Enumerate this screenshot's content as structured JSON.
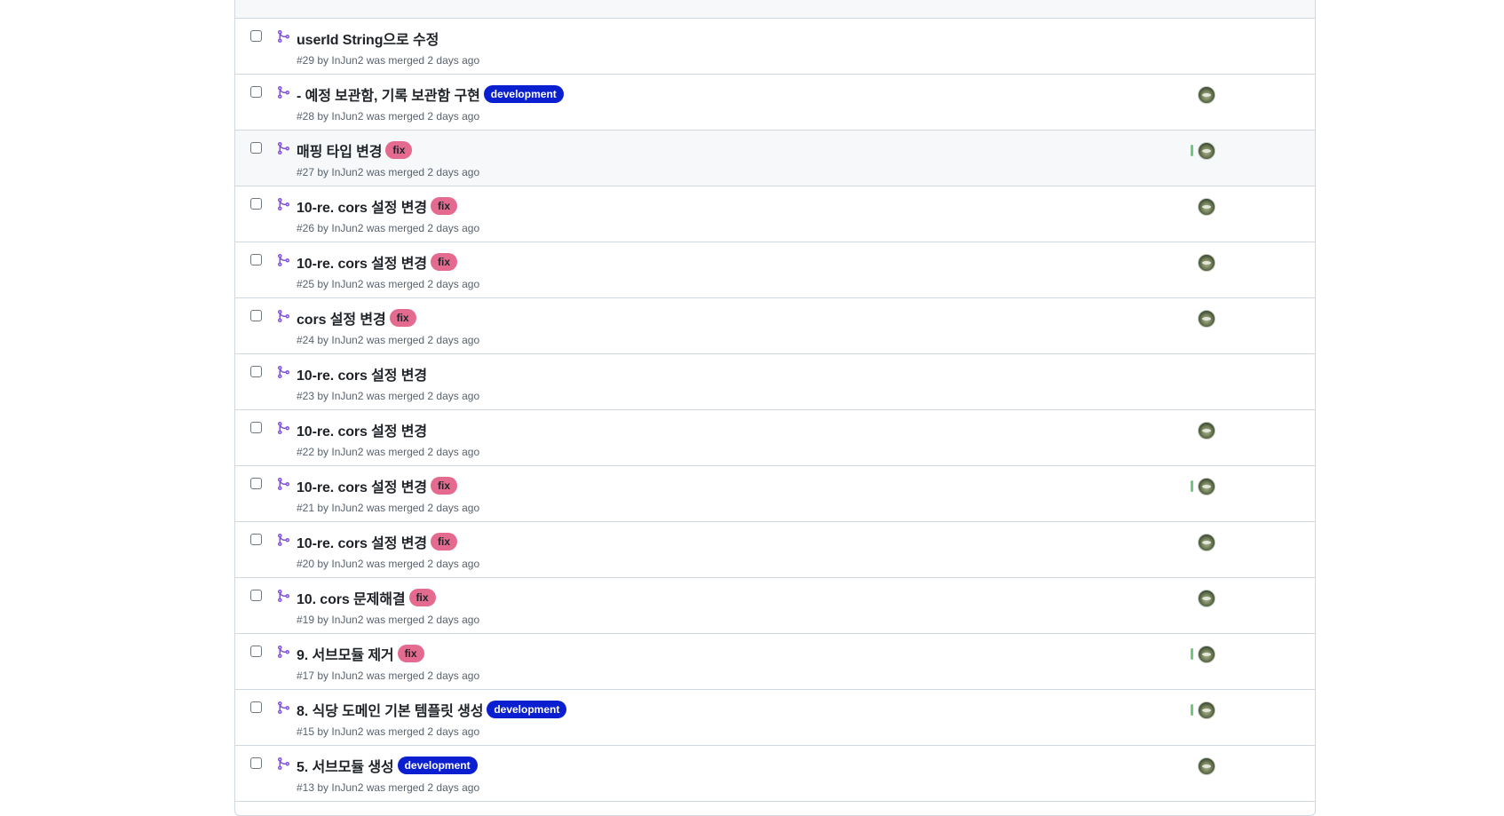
{
  "pull_requests": [
    {
      "title": "userId String으로 수정",
      "meta": "#29 by InJun2 was merged 2 days ago",
      "labels": [],
      "avatar": false,
      "ci": false
    },
    {
      "title": "- 예정 보관함, 기록 보관함 구현",
      "meta": "#28 by InJun2 was merged 2 days ago",
      "labels": [
        {
          "text": "development",
          "kind": "development"
        }
      ],
      "avatar": true,
      "ci": false
    },
    {
      "title": "매핑 타입 변경",
      "meta": "#27 by InJun2 was merged 2 days ago",
      "labels": [
        {
          "text": "fix",
          "kind": "fix"
        }
      ],
      "avatar": true,
      "ci": true,
      "hover": true
    },
    {
      "title": "10-re. cors 설정 변경",
      "meta": "#26 by InJun2 was merged 2 days ago",
      "labels": [
        {
          "text": "fix",
          "kind": "fix"
        }
      ],
      "avatar": true,
      "ci": false
    },
    {
      "title": "10-re. cors 설정 변경",
      "meta": "#25 by InJun2 was merged 2 days ago",
      "labels": [
        {
          "text": "fix",
          "kind": "fix"
        }
      ],
      "avatar": true,
      "ci": false
    },
    {
      "title": "cors 설정 변경",
      "meta": "#24 by InJun2 was merged 2 days ago",
      "labels": [
        {
          "text": "fix",
          "kind": "fix"
        }
      ],
      "avatar": true,
      "ci": false
    },
    {
      "title": "10-re. cors 설정 변경",
      "meta": "#23 by InJun2 was merged 2 days ago",
      "labels": [],
      "avatar": false,
      "ci": false
    },
    {
      "title": "10-re. cors 설정 변경",
      "meta": "#22 by InJun2 was merged 2 days ago",
      "labels": [],
      "avatar": true,
      "ci": false
    },
    {
      "title": "10-re. cors 설정 변경",
      "meta": "#21 by InJun2 was merged 2 days ago",
      "labels": [
        {
          "text": "fix",
          "kind": "fix"
        }
      ],
      "avatar": true,
      "ci": true
    },
    {
      "title": "10-re. cors 설정 변경",
      "meta": "#20 by InJun2 was merged 2 days ago",
      "labels": [
        {
          "text": "fix",
          "kind": "fix"
        }
      ],
      "avatar": true,
      "ci": false
    },
    {
      "title": "10. cors 문제해결",
      "meta": "#19 by InJun2 was merged 2 days ago",
      "labels": [
        {
          "text": "fix",
          "kind": "fix"
        }
      ],
      "avatar": true,
      "ci": false
    },
    {
      "title": "9. 서브모듈 제거",
      "meta": "#17 by InJun2 was merged 2 days ago",
      "labels": [
        {
          "text": "fix",
          "kind": "fix"
        }
      ],
      "avatar": true,
      "ci": true
    },
    {
      "title": "8. 식당 도메인 기본 템플릿 생성",
      "meta": "#15 by InJun2 was merged 2 days ago",
      "labels": [
        {
          "text": "development",
          "kind": "development"
        }
      ],
      "avatar": true,
      "ci": true
    },
    {
      "title": "5. 서브모듈 생성",
      "meta": "#13 by InJun2 was merged 2 days ago",
      "labels": [
        {
          "text": "development",
          "kind": "development"
        }
      ],
      "avatar": true,
      "ci": false
    }
  ],
  "colors": {
    "merged_icon": "#8250df",
    "label_development": "#0a1fcf",
    "label_fix": "#e46a8f",
    "border": "#d0d7de",
    "meta_text": "#59636e"
  },
  "icons": {
    "merged": "git-merge-icon",
    "avatar": "user-avatar"
  }
}
